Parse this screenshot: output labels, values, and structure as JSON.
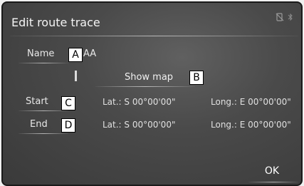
{
  "header": {
    "title": "Edit route trace"
  },
  "status_icons": [
    "phone-off-icon",
    "bluetooth-icon"
  ],
  "rows": {
    "name": {
      "label": "Name",
      "value": "AA",
      "badge": "A"
    },
    "map": {
      "label": "Show map",
      "badge": "B"
    },
    "start": {
      "label": "Start",
      "badge": "C",
      "lat": "Lat.: S 00°00'00\"",
      "lng": "Long.: E 00°00'00\""
    },
    "end": {
      "label": "End",
      "badge": "D",
      "lat": "Lat.: S 00°00'00\"",
      "lng": "Long.: E 00°00'00\""
    }
  },
  "footer": {
    "ok_label": "OK"
  }
}
